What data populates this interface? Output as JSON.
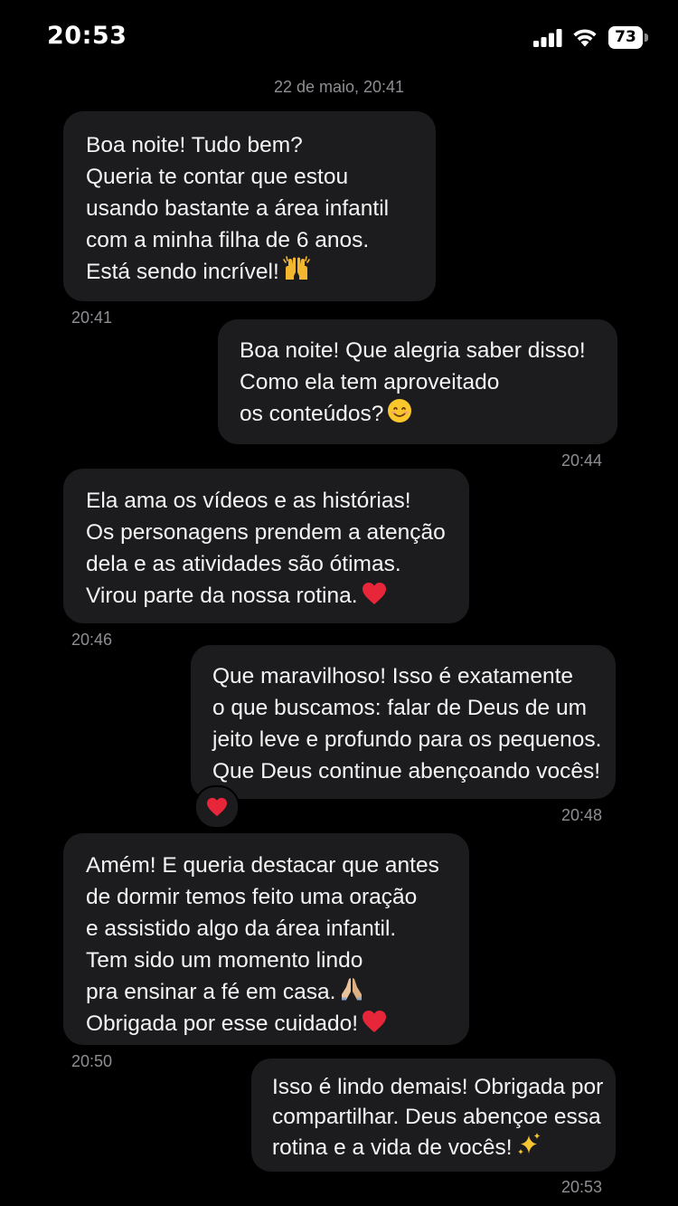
{
  "status_bar": {
    "time": "20:53",
    "battery": "73"
  },
  "date_separator": "22 de maio, 20:41",
  "messages": [
    {
      "direction": "incoming",
      "lines": [
        "Boa noite! Tudo bem?",
        "Queria te contar que estou",
        "usando bastante a área infantil",
        "com a minha filha de 6 anos.",
        "Está sendo incrível!"
      ],
      "emoji": "raising-hands",
      "time": "20:41"
    },
    {
      "direction": "outgoing",
      "lines": [
        "Boa noite! Que alegria saber disso!",
        "Como ela tem aproveitado",
        "os conteúdos?"
      ],
      "emoji": "smiling-face",
      "time": "20:44"
    },
    {
      "direction": "incoming",
      "lines": [
        "Ela ama os vídeos e as histórias!",
        "Os personagens prendem a atenção",
        "dela e as atividades são ótimas.",
        "Virou parte da nossa rotina."
      ],
      "emoji": "red-heart",
      "time": "20:46"
    },
    {
      "direction": "outgoing",
      "lines": [
        "Que maravilhoso! Isso é exatamente",
        "o que buscamos: falar de Deus de um",
        "jeito leve e profundo para os pequenos.",
        "Que Deus continue abençoando vocês!"
      ],
      "emoji": "",
      "reaction": "red-heart",
      "time": "20:48"
    },
    {
      "direction": "incoming",
      "lines": [
        "Amém! E queria destacar que antes",
        "de dormir temos feito uma oração",
        "e assistido algo da área infantil.",
        "Tem sido um momento lindo",
        "pra ensinar a fé em casa.",
        "Obrigada por esse cuidado!"
      ],
      "line_emojis": [
        "",
        "",
        "",
        "",
        "folded-hands",
        "red-heart"
      ],
      "time": "20:50"
    },
    {
      "direction": "outgoing",
      "lines": [
        "Isso é lindo demais! Obrigada por",
        "compartilhar. Deus abençoe essa",
        "rotina e a vida de vocês!"
      ],
      "emoji": "sparkles",
      "time": "20:53"
    }
  ],
  "colors": {
    "background": "#000000",
    "bubble": "#1c1c1e",
    "text": "#f4f4f4",
    "meta": "#8e8e93",
    "heart": "#e8263a"
  }
}
